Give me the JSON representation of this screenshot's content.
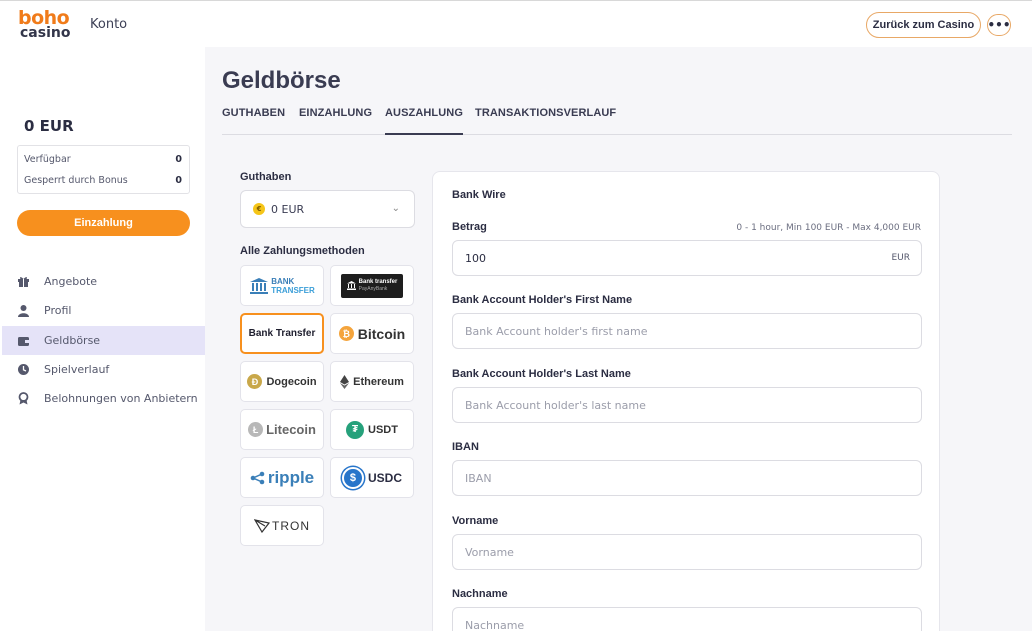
{
  "header": {
    "logo_top": "boho",
    "logo_bottom": "casino",
    "section": "Konto",
    "back_button": "Zurück zum Casino",
    "more_button": "•••"
  },
  "sidebar": {
    "balance": "0 EUR",
    "available_label": "Verfügbar",
    "available_value": "0",
    "locked_label": "Gesperrt durch Bonus",
    "locked_value": "0",
    "deposit_button": "Einzahlung",
    "items": [
      {
        "label": "Angebote",
        "icon": "gift-icon"
      },
      {
        "label": "Profil",
        "icon": "user-icon"
      },
      {
        "label": "Geldbörse",
        "icon": "wallet-icon",
        "active": true
      },
      {
        "label": "Spielverlauf",
        "icon": "history-icon"
      },
      {
        "label": "Belohnungen von Anbietern",
        "icon": "medal-icon"
      }
    ]
  },
  "main": {
    "title": "Geldbörse",
    "tabs": [
      {
        "label": "GUTHABEN"
      },
      {
        "label": "EINZAHLUNG"
      },
      {
        "label": "AUSZAHLUNG",
        "active": true
      },
      {
        "label": "TRANSAKTIONSVERLAUF"
      }
    ],
    "balance_label": "Guthaben",
    "balance_select": "0 EUR",
    "methods_label": "Alle Zahlungsmethoden",
    "methods": [
      {
        "name": "bank-transfer-logo",
        "line1": "BANK",
        "line2": "TRANSFER"
      },
      {
        "name": "bank-transfer-payanybank",
        "line1": "Bank transfer",
        "line2": "PayAnyBank"
      },
      {
        "name": "bank-transfer",
        "label": "Bank Transfer",
        "selected": true
      },
      {
        "name": "bitcoin",
        "label": "Bitcoin"
      },
      {
        "name": "dogecoin",
        "label": "Dogecoin"
      },
      {
        "name": "ethereum",
        "label": "Ethereum"
      },
      {
        "name": "litecoin",
        "label": "Litecoin"
      },
      {
        "name": "usdt",
        "label": "USDT"
      },
      {
        "name": "ripple",
        "label": "ripple"
      },
      {
        "name": "usdc",
        "label": "USDC"
      },
      {
        "name": "tron",
        "label": "TRON"
      }
    ],
    "form": {
      "method_title": "Bank Wire",
      "amount_label": "Betrag",
      "amount_hint": "0 - 1 hour, Min 100 EUR - Max 4,000 EUR",
      "amount_value": "100",
      "amount_currency": "EUR",
      "first_name_label": "Bank Account Holder's First Name",
      "first_name_placeholder": "Bank Account holder's first name",
      "last_name_label": "Bank Account Holder's Last Name",
      "last_name_placeholder": "Bank Account holder's last name",
      "iban_label": "IBAN",
      "iban_placeholder": "IBAN",
      "vorname_label": "Vorname",
      "vorname_placeholder": "Vorname",
      "nachname_label": "Nachname",
      "nachname_placeholder": "Nachname"
    }
  }
}
